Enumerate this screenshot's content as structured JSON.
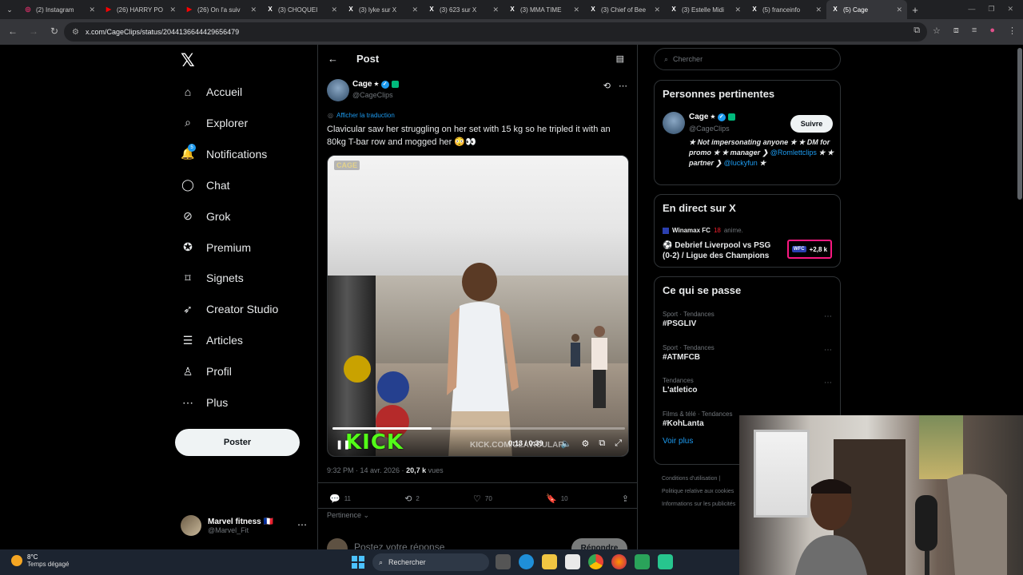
{
  "browser": {
    "tabs": [
      {
        "title": "(2) Instagram",
        "icon": "instagram-icon",
        "color": "#e1306c"
      },
      {
        "title": "(26) HARRY PO",
        "icon": "youtube-icon",
        "color": "#ff0000"
      },
      {
        "title": "(26) On l'a suiv",
        "icon": "youtube-icon",
        "color": "#ff0000"
      },
      {
        "title": "(3) CHOQUEI",
        "icon": "x-icon",
        "color": "#ffffff"
      },
      {
        "title": "(3) lyke sur X",
        "icon": "x-icon",
        "color": "#ffffff"
      },
      {
        "title": "(3) 623 sur X",
        "icon": "x-icon",
        "color": "#ffffff"
      },
      {
        "title": "(3) MMA TIME",
        "icon": "x-icon",
        "color": "#ffffff"
      },
      {
        "title": "(3) Chief of Bee",
        "icon": "x-icon",
        "color": "#ffffff"
      },
      {
        "title": "(3) Estelle Midi",
        "icon": "x-icon",
        "color": "#ffffff"
      },
      {
        "title": "(5) franceinfo",
        "icon": "x-icon",
        "color": "#ffffff"
      },
      {
        "title": "(5) Cage",
        "icon": "x-icon",
        "color": "#ffffff",
        "active": true
      }
    ],
    "url": "x.com/CageClips/status/2044136644429656479"
  },
  "sidebar": {
    "logo": "𝕏",
    "items": [
      {
        "label": "Accueil",
        "icon": "home-icon"
      },
      {
        "label": "Explorer",
        "icon": "search-icon"
      },
      {
        "label": "Notifications",
        "icon": "bell-icon",
        "badge": "5"
      },
      {
        "label": "Chat",
        "icon": "chat-icon"
      },
      {
        "label": "Grok",
        "icon": "grok-icon"
      },
      {
        "label": "Premium",
        "icon": "premium-icon"
      },
      {
        "label": "Signets",
        "icon": "bookmark-icon"
      },
      {
        "label": "Creator Studio",
        "icon": "rocket-icon"
      },
      {
        "label": "Articles",
        "icon": "articles-icon"
      },
      {
        "label": "Profil",
        "icon": "person-icon"
      },
      {
        "label": "Plus",
        "icon": "more-circle-icon"
      }
    ],
    "post_button": "Poster",
    "account": {
      "name": "Marvel fitness 🇫🇷",
      "handle": "@Marvel_Fit"
    }
  },
  "main": {
    "title": "Post",
    "post": {
      "author": "Cage ⭑",
      "handle": "@CageClips",
      "translate": "Afficher la traduction",
      "text": "Clavicular saw her struggling on her set with 15 kg so he tripled it with an 80kg T-bar row and mogged her 😳👀",
      "video": {
        "watermark": "CAGE",
        "brand": "KICK",
        "url_overlay": "KICK.COM/CLAVICULAR",
        "time": "0:13 / 0:39",
        "progress": 0.34
      },
      "time": "9:32 PM · 14 avr. 2026 · ",
      "views_count": "20,7 k",
      "views_label": " vues",
      "stats": {
        "replies": "11",
        "reposts": "2",
        "likes": "70",
        "bookmarks": "10"
      },
      "sort": "Pertinence",
      "reply_placeholder": "Postez votre réponse",
      "reply_button": "Répondre"
    }
  },
  "right": {
    "search_placeholder": "Chercher",
    "relevant": {
      "title": "Personnes pertinentes",
      "name": "Cage ⭑",
      "handle": "@CageClips",
      "follow": "Suivre",
      "bio_line1": "★ Not impersonating anyone ★ ★ DM for promo ★ ★ manager ❯",
      "mention1": "@Romlettclips",
      "bio_mid": " ★ ★ partner ❯",
      "mention2": "@luckyfun",
      "bio_end": " ★"
    },
    "live": {
      "title": "En direct sur X",
      "host": "Winamax FC",
      "host_extra": "18",
      "host_status": "anime.",
      "event": "⚽ Debrief Liverpool vs PSG (0-2) / Ligue des Champions",
      "pill_logo": "WFC",
      "pill_count": "+2,8 k"
    },
    "trends": {
      "title": "Ce qui se passe",
      "items": [
        {
          "category": "Sport · Tendances",
          "tag": "#PSGLIV"
        },
        {
          "category": "Sport · Tendances",
          "tag": "#ATMFCB"
        },
        {
          "category": "Tendances",
          "tag": "L'atletico"
        },
        {
          "category": "Films & télé · Tendances",
          "tag": "#KohLanta"
        }
      ],
      "more": "Voir plus"
    },
    "footer": [
      "Conditions d'utilisation  |",
      "Politique relative aux cookies",
      "Informations sur les publicités"
    ]
  },
  "taskbar": {
    "temp": "8°C",
    "weather": "Temps dégagé",
    "search": "Rechercher"
  }
}
